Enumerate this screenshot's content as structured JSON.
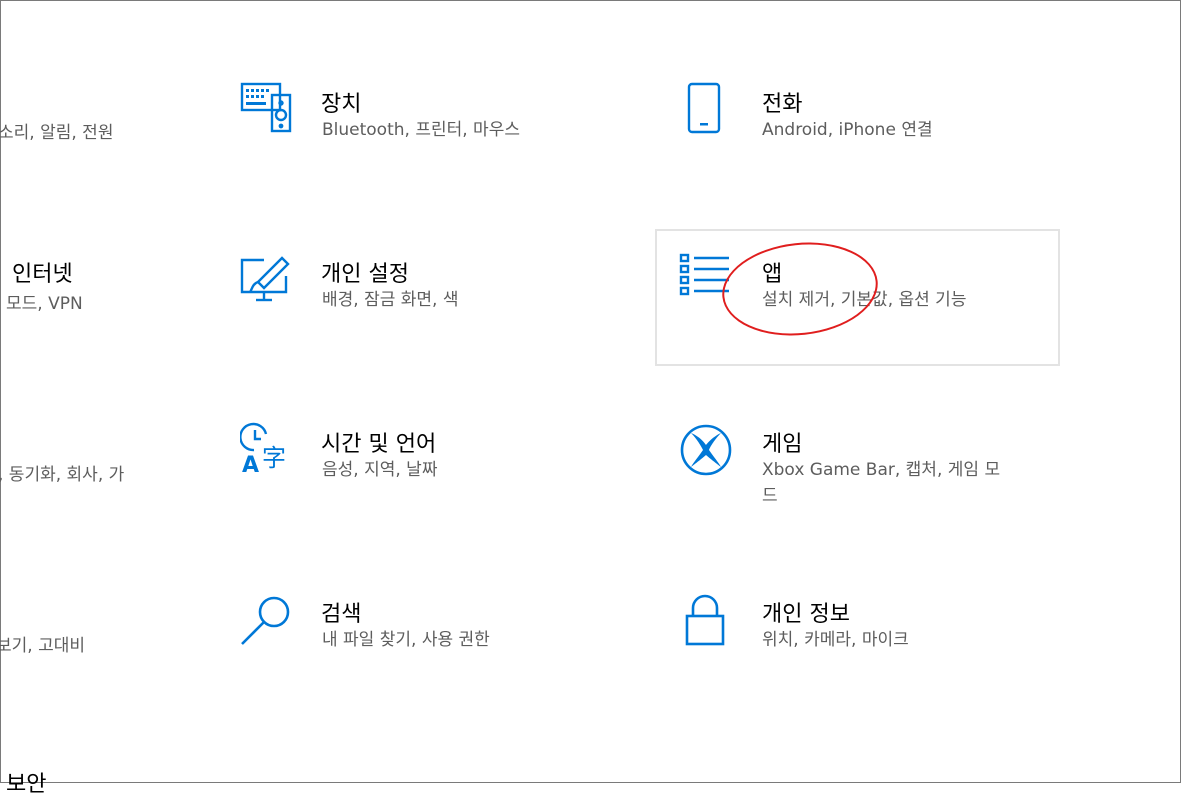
{
  "left_column_partial": [
    {
      "title": "",
      "desc": "소리, 알림, 전원"
    },
    {
      "title": "인터넷",
      "desc": "모드, VPN"
    },
    {
      "title": "",
      "desc": ", 동기화, 회사, 가"
    },
    {
      "title": "",
      "desc": "보기, 고대비"
    },
    {
      "title": "보안",
      "desc": ""
    }
  ],
  "tiles": [
    {
      "id": "devices",
      "icon": "keyboard-speaker-icon",
      "title": "장치",
      "desc": "Bluetooth, 프린터, 마우스"
    },
    {
      "id": "phone",
      "icon": "phone-icon",
      "title": "전화",
      "desc": "Android, iPhone 연결"
    },
    {
      "id": "personalization",
      "icon": "paint-monitor-icon",
      "title": "개인 설정",
      "desc": "배경, 잠금 화면, 색"
    },
    {
      "id": "apps",
      "icon": "apps-list-icon",
      "title": "앱",
      "desc": "설치 제거, 기본값, 옵션 기능"
    },
    {
      "id": "time-language",
      "icon": "clock-language-icon",
      "title": "시간 및 언어",
      "desc": "음성, 지역, 날짜"
    },
    {
      "id": "gaming",
      "icon": "xbox-icon",
      "title": "게임",
      "desc": "Xbox Game Bar, 캡처, 게임 모",
      "desc2": "드"
    },
    {
      "id": "search",
      "icon": "search-icon",
      "title": "검색",
      "desc": "내 파일 찾기, 사용 권한"
    },
    {
      "id": "privacy",
      "icon": "lock-icon",
      "title": "개인 정보",
      "desc": "위치, 카메라, 마이크"
    }
  ],
  "colors": {
    "accent": "#0078d7",
    "annotation": "#e01e1e",
    "desc_text": "#5d5d5d"
  }
}
